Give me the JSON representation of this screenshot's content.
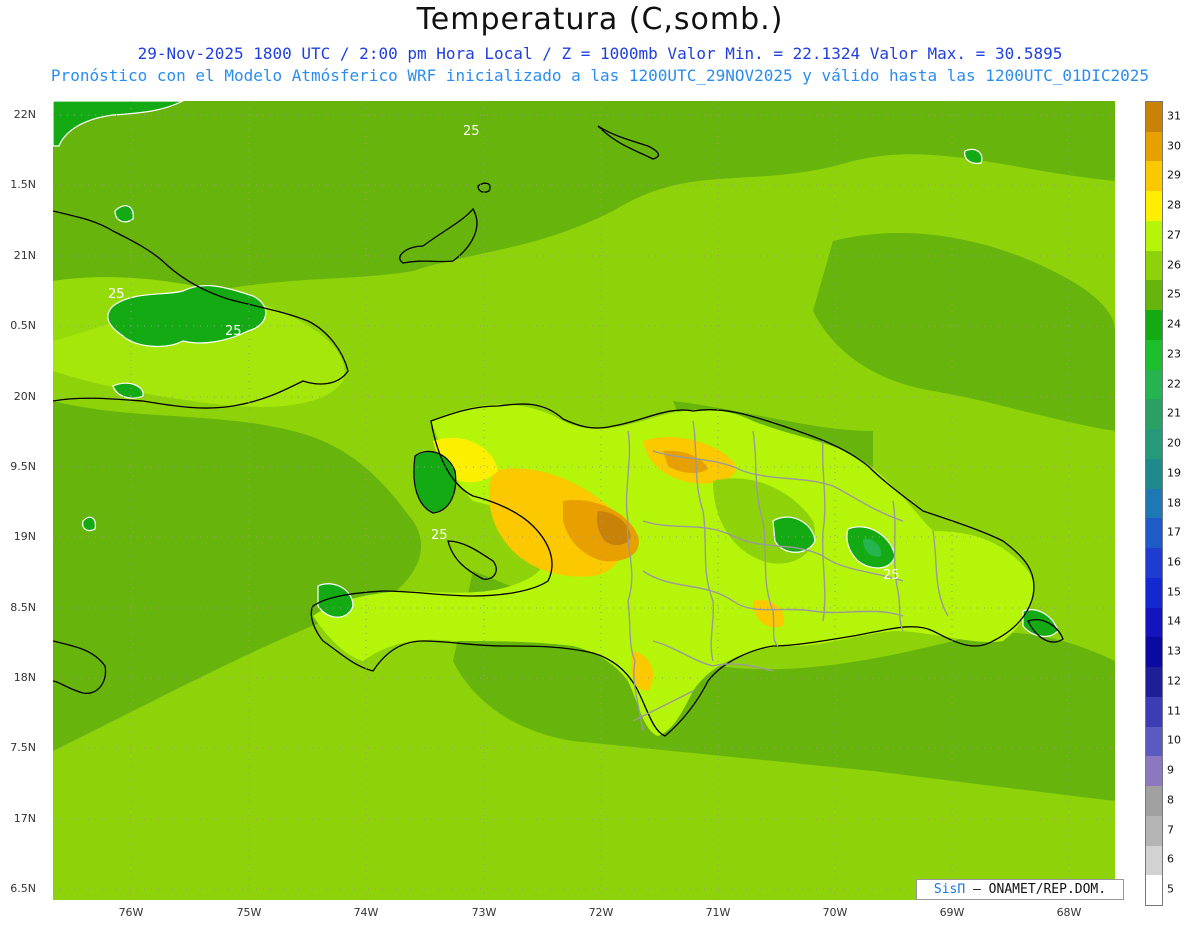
{
  "title": "Temperatura (C,somb.)",
  "subtitle_line1": "29-Nov-2025  1800 UTC / 2:00 pm Hora Local / Z = 1000mb   Valor Min. = 22.1324  Valor Max. = 30.5895",
  "subtitle_line2": "Pronóstico con el Modelo Atmósferico WRF inicializado a las 1200UTC_29NOV2025 y válido hasta las  1200UTC_01DIC2025",
  "lat_labels": [
    "22N",
    "1.5N",
    "21N",
    "0.5N",
    "20N",
    "9.5N",
    "19N",
    "8.5N",
    "18N",
    "7.5N",
    "17N",
    "6.5N"
  ],
  "lon_labels": [
    "76W",
    "75W",
    "74W",
    "73W",
    "72W",
    "71W",
    "70W",
    "69W",
    "68W"
  ],
  "legend": {
    "labels": [
      "31",
      "30",
      "29",
      "28",
      "27",
      "26",
      "25",
      "24",
      "23",
      "22",
      "21",
      "20",
      "19",
      "18",
      "17",
      "16",
      "15",
      "14",
      "13",
      "12",
      "11",
      "10",
      "9",
      "8",
      "7",
      "6",
      "5"
    ],
    "colors": [
      "#c88208",
      "#e8a000",
      "#fcc800",
      "#fcf000",
      "#b4f50a",
      "#8ed20a",
      "#66b40c",
      "#14aa14",
      "#1cbe2c",
      "#26b450",
      "#2aa064",
      "#249a78",
      "#1e8a8c",
      "#1e78b4",
      "#1e5ac8",
      "#1e3cd2",
      "#1428d2",
      "#1414be",
      "#0a0aa0",
      "#1e1e96",
      "#3c3cb4",
      "#5a5ac0",
      "#8c78be",
      "#a0a0a0",
      "#b4b4b4",
      "#d2d2d2",
      "#ffffff"
    ]
  },
  "contour_labels": [
    "25",
    "25",
    "25",
    "25",
    "25"
  ],
  "credit": {
    "brand": "SisΠ",
    "text": " – ONAMET/REP.DOM."
  },
  "colors": {
    "ocean_field": "#8ed20a",
    "ocean_warm": "#b4f50a",
    "cool_band": "#66b40c",
    "coastline": "#000000",
    "borders": "#9a9a9a",
    "contour": "#ffffff"
  }
}
